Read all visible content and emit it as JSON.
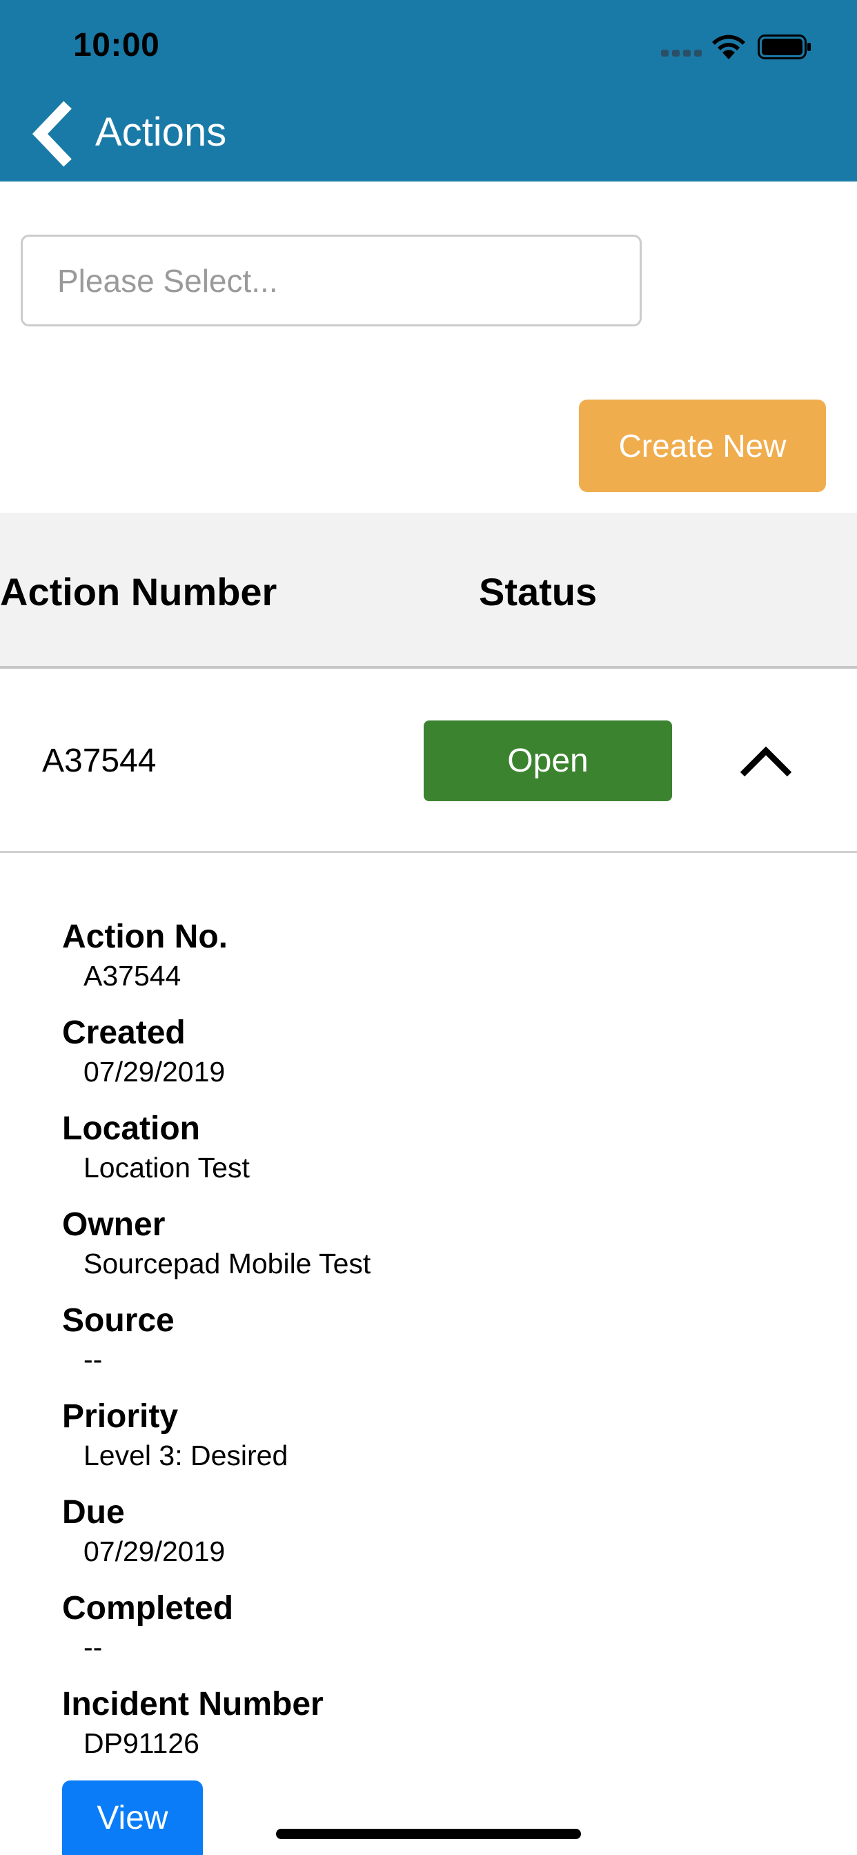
{
  "status_bar": {
    "time": "10:00"
  },
  "nav": {
    "title": "Actions"
  },
  "select": {
    "placeholder": "Please Select..."
  },
  "create_button": {
    "label": "Create New"
  },
  "table": {
    "headers": {
      "action_number": "Action Number",
      "status": "Status"
    },
    "row": {
      "number": "A37544",
      "status": "Open"
    }
  },
  "details": {
    "action_no": {
      "label": "Action No.",
      "value": "A37544"
    },
    "created": {
      "label": "Created",
      "value": "07/29/2019"
    },
    "location": {
      "label": "Location",
      "value": "Location Test"
    },
    "owner": {
      "label": "Owner",
      "value": "Sourcepad Mobile Test"
    },
    "source": {
      "label": "Source",
      "value": "--"
    },
    "priority": {
      "label": "Priority",
      "value": "Level 3: Desired"
    },
    "due": {
      "label": "Due",
      "value": "07/29/2019"
    },
    "completed": {
      "label": "Completed",
      "value": "--"
    },
    "incident_number": {
      "label": "Incident Number",
      "value": "DP91126"
    }
  },
  "view_button": {
    "label": "View"
  },
  "colors": {
    "header": "#1a7aa7",
    "create_button": "#f0ad4e",
    "status_open": "#3c8330",
    "view_button": "#0a7cf8"
  },
  "icons": {
    "back": "chevron-left-icon",
    "row_toggle": "chevron-up-icon",
    "wifi": "wifi-icon",
    "battery": "battery-icon",
    "signal": "cellular-signal-icon"
  }
}
